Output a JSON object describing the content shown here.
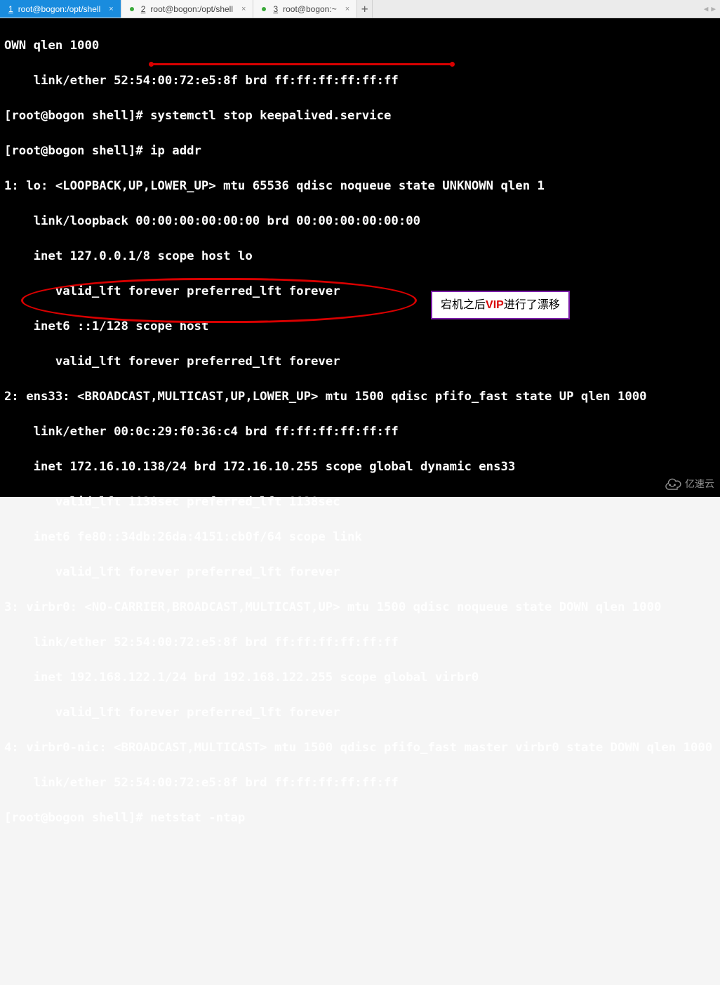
{
  "tabs": [
    {
      "num": "1",
      "title": "root@bogon:/opt/shell"
    },
    {
      "num": "2",
      "title": "root@bogon:/opt/shell"
    },
    {
      "num": "3",
      "title": "root@bogon:~"
    }
  ],
  "terminal": {
    "lines": [
      "OWN qlen 1000",
      "    link/ether 52:54:00:72:e5:8f brd ff:ff:ff:ff:ff:ff",
      "[root@bogon shell]# systemctl stop keepalived.service",
      "[root@bogon shell]# ip addr",
      "1: lo: <LOOPBACK,UP,LOWER_UP> mtu 65536 qdisc noqueue state UNKNOWN qlen 1",
      "    link/loopback 00:00:00:00:00:00 brd 00:00:00:00:00:00",
      "    inet 127.0.0.1/8 scope host lo",
      "       valid_lft forever preferred_lft forever",
      "    inet6 ::1/128 scope host ",
      "       valid_lft forever preferred_lft forever",
      "2: ens33: <BROADCAST,MULTICAST,UP,LOWER_UP> mtu 1500 qdisc pfifo_fast state UP qlen 1000",
      "    link/ether 00:0c:29:f0:36:c4 brd ff:ff:ff:ff:ff:ff",
      "    inet 172.16.10.138/24 brd 172.16.10.255 scope global dynamic ens33",
      "       valid_lft 1138sec preferred_lft 1138sec",
      "    inet6 fe80::34db:26da:4151:cb0f/64 scope link ",
      "       valid_lft forever preferred_lft forever",
      "3: virbr0: <NO-CARRIER,BROADCAST,MULTICAST,UP> mtu 1500 qdisc noqueue state DOWN qlen 1000",
      "    link/ether 52:54:00:72:e5:8f brd ff:ff:ff:ff:ff:ff",
      "    inet 192.168.122.1/24 brd 192.168.122.255 scope global virbr0",
      "       valid_lft forever preferred_lft forever",
      "4: virbr0-nic: <BROADCAST,MULTICAST> mtu 1500 qdisc pfifo_fast master virbr0 state DOWN qlen 1000",
      "    link/ether 52:54:00:72:e5:8f brd ff:ff:ff:ff:ff:ff",
      "[root@bogon shell]# netstat -ntap"
    ]
  },
  "annotations": {
    "underline_cmd": "systemctl stop keepalived.service",
    "circled_line": "inet6 fe80::34db:26da:4151:cb0f/64 scope link",
    "box_text_prefix": "宕机之后",
    "box_text_vip": "VIP",
    "box_text_suffix": "进行了漂移"
  },
  "watermark": "亿速云"
}
